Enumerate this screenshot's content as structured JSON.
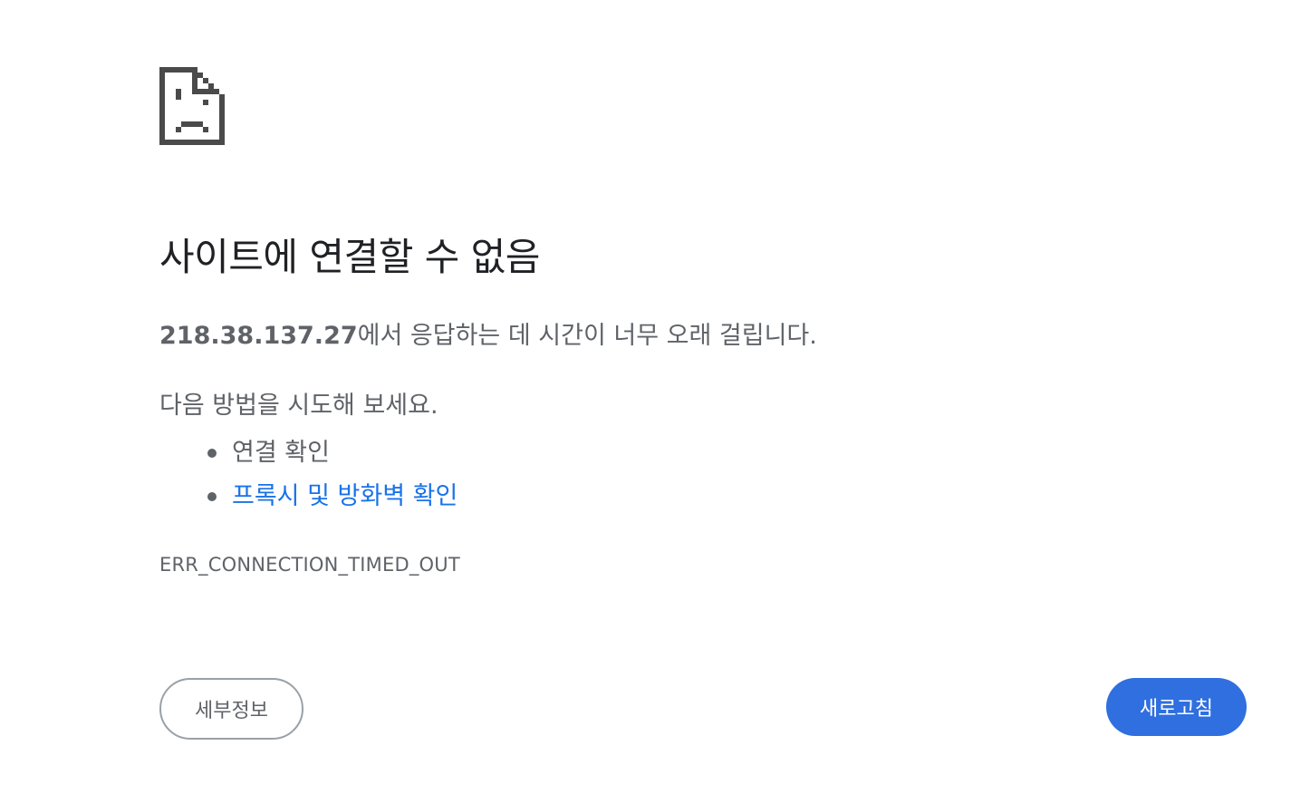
{
  "icon": "sad-document-icon",
  "title": "사이트에 연결할 수 없음",
  "summary": {
    "host": "218.38.137.27",
    "message": "에서 응답하는 데 시간이 너무 오래 걸립니다."
  },
  "suggestions": {
    "heading": "다음 방법을 시도해 보세요.",
    "items": [
      {
        "label": "연결 확인",
        "link": false
      },
      {
        "label": "프록시 및 방화벽 확인",
        "link": true
      }
    ]
  },
  "error_code": "ERR_CONNECTION_TIMED_OUT",
  "buttons": {
    "details": "세부정보",
    "reload": "새로고침"
  },
  "colors": {
    "title": "#202124",
    "text": "#5f6368",
    "link": "#1a73e8",
    "primary_button": "#2f6fe0",
    "icon": "#4a4a4a"
  }
}
